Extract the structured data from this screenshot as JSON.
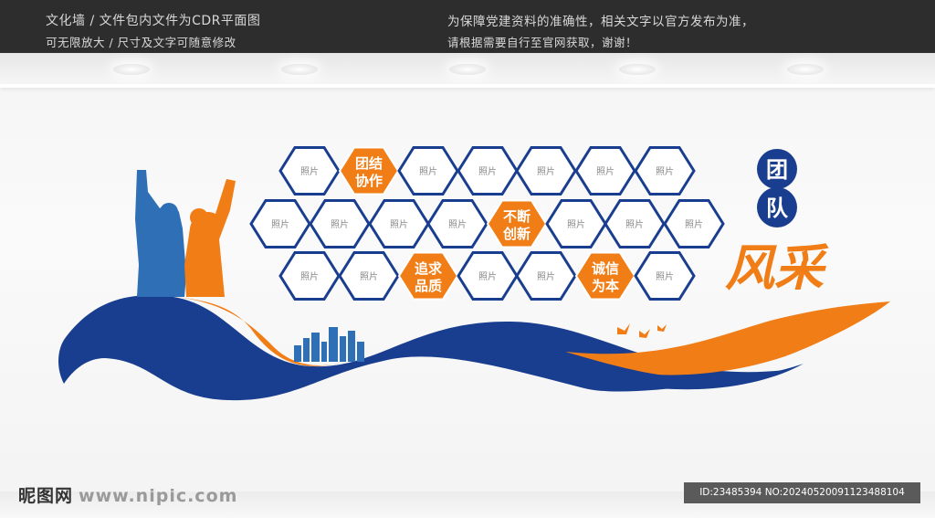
{
  "header": {
    "left_line1": "文化墙 / 文件包内文件为CDR平面图",
    "left_line2": "可无限放大 / 尺寸及文字可随意修改",
    "right_line1": "为保障党建资料的准确性，相关文字以官方发布为准，",
    "right_line2": "请根据需要自行至官网获取，谢谢！"
  },
  "panel": {
    "title_chars": [
      "团",
      "队"
    ],
    "calligraphy": "风采",
    "placeholder": "照片",
    "slogans": {
      "unity": [
        "团结",
        "协作"
      ],
      "innovation": [
        "不断",
        "创新"
      ],
      "quality": [
        "追求",
        "品质"
      ],
      "integrity": [
        "诚信",
        "为本"
      ]
    }
  },
  "footer": {
    "logo": "昵图网",
    "site": "www.nipic.com",
    "id_line": "ID:23485394 NO:20240520091123488104"
  },
  "colors": {
    "blue": "#1a3e8f",
    "orange": "#f07d16",
    "figure_blue": "#2f6fb5",
    "bar": "#2d2d2d"
  }
}
